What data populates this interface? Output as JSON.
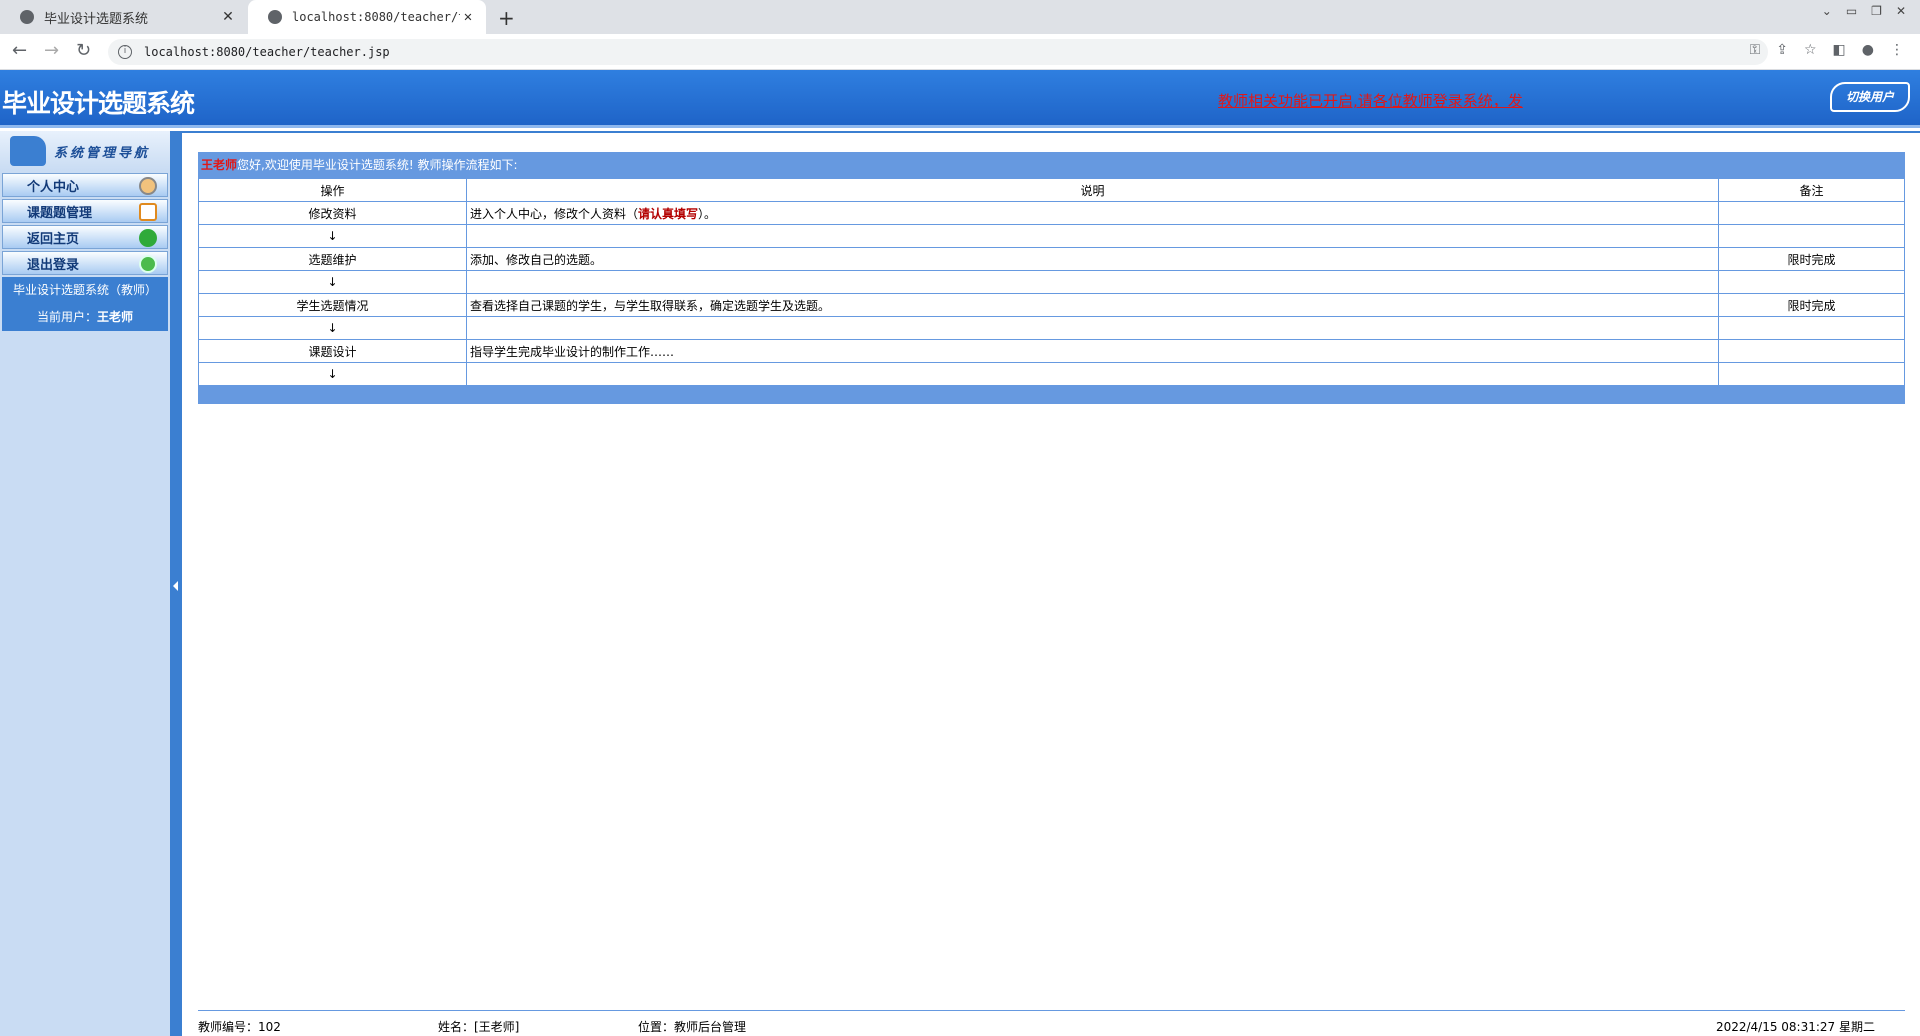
{
  "browser": {
    "tabs": [
      {
        "title": "毕业设计选题系统"
      },
      {
        "title": "localhost:8080/teacher/teacher.jsp"
      }
    ],
    "url": "localhost:8080/teacher/teacher.jsp"
  },
  "header": {
    "title": "毕业设计选题系统",
    "marquee": "教师相关功能已开启,请各位教师登录系统，发",
    "switch_user": "切换用户"
  },
  "sidebar": {
    "heading": "系统管理导航",
    "items": [
      {
        "label": "个人中心"
      },
      {
        "label": "课题题管理"
      },
      {
        "label": "返回主页"
      },
      {
        "label": "退出登录"
      }
    ],
    "system_label": "毕业设计选题系统（教师）",
    "current_user_prefix": "当前用户：",
    "current_user": "王老师"
  },
  "main": {
    "greeting_name": "王老师",
    "greeting_text": "您好,欢迎使用毕业设计选题系统!  教师操作流程如下:",
    "columns": [
      "操作",
      "说明",
      "备注"
    ],
    "rows": [
      {
        "op": "修改资料",
        "desc": "进入个人中心，修改个人资料（",
        "desc_hl": "请认真填写",
        "desc_tail": "）。",
        "note": ""
      },
      {
        "op": "↓",
        "desc": "",
        "desc_hl": "",
        "desc_tail": "",
        "note": ""
      },
      {
        "op": "选题维护",
        "desc": "添加、修改自己的选题。",
        "desc_hl": "",
        "desc_tail": "",
        "note": "限时完成"
      },
      {
        "op": "↓",
        "desc": "",
        "desc_hl": "",
        "desc_tail": "",
        "note": ""
      },
      {
        "op": "学生选题情况",
        "desc": "查看选择自己课题的学生，与学生取得联系，确定选题学生及选题。",
        "desc_hl": "",
        "desc_tail": "",
        "note": "限时完成"
      },
      {
        "op": "↓",
        "desc": "",
        "desc_hl": "",
        "desc_tail": "",
        "note": ""
      },
      {
        "op": "课题设计",
        "desc": "指导学生完成毕业设计的制作工作……",
        "desc_hl": "",
        "desc_tail": "",
        "note": ""
      },
      {
        "op": "↓",
        "desc": "",
        "desc_hl": "",
        "desc_tail": "",
        "note": ""
      }
    ]
  },
  "footer": {
    "teacher_id": "教师编号：102",
    "name": "姓名：[王老师]",
    "location": "位置：教师后台管理",
    "datetime": "2022/4/15 08:31:27 星期二"
  }
}
